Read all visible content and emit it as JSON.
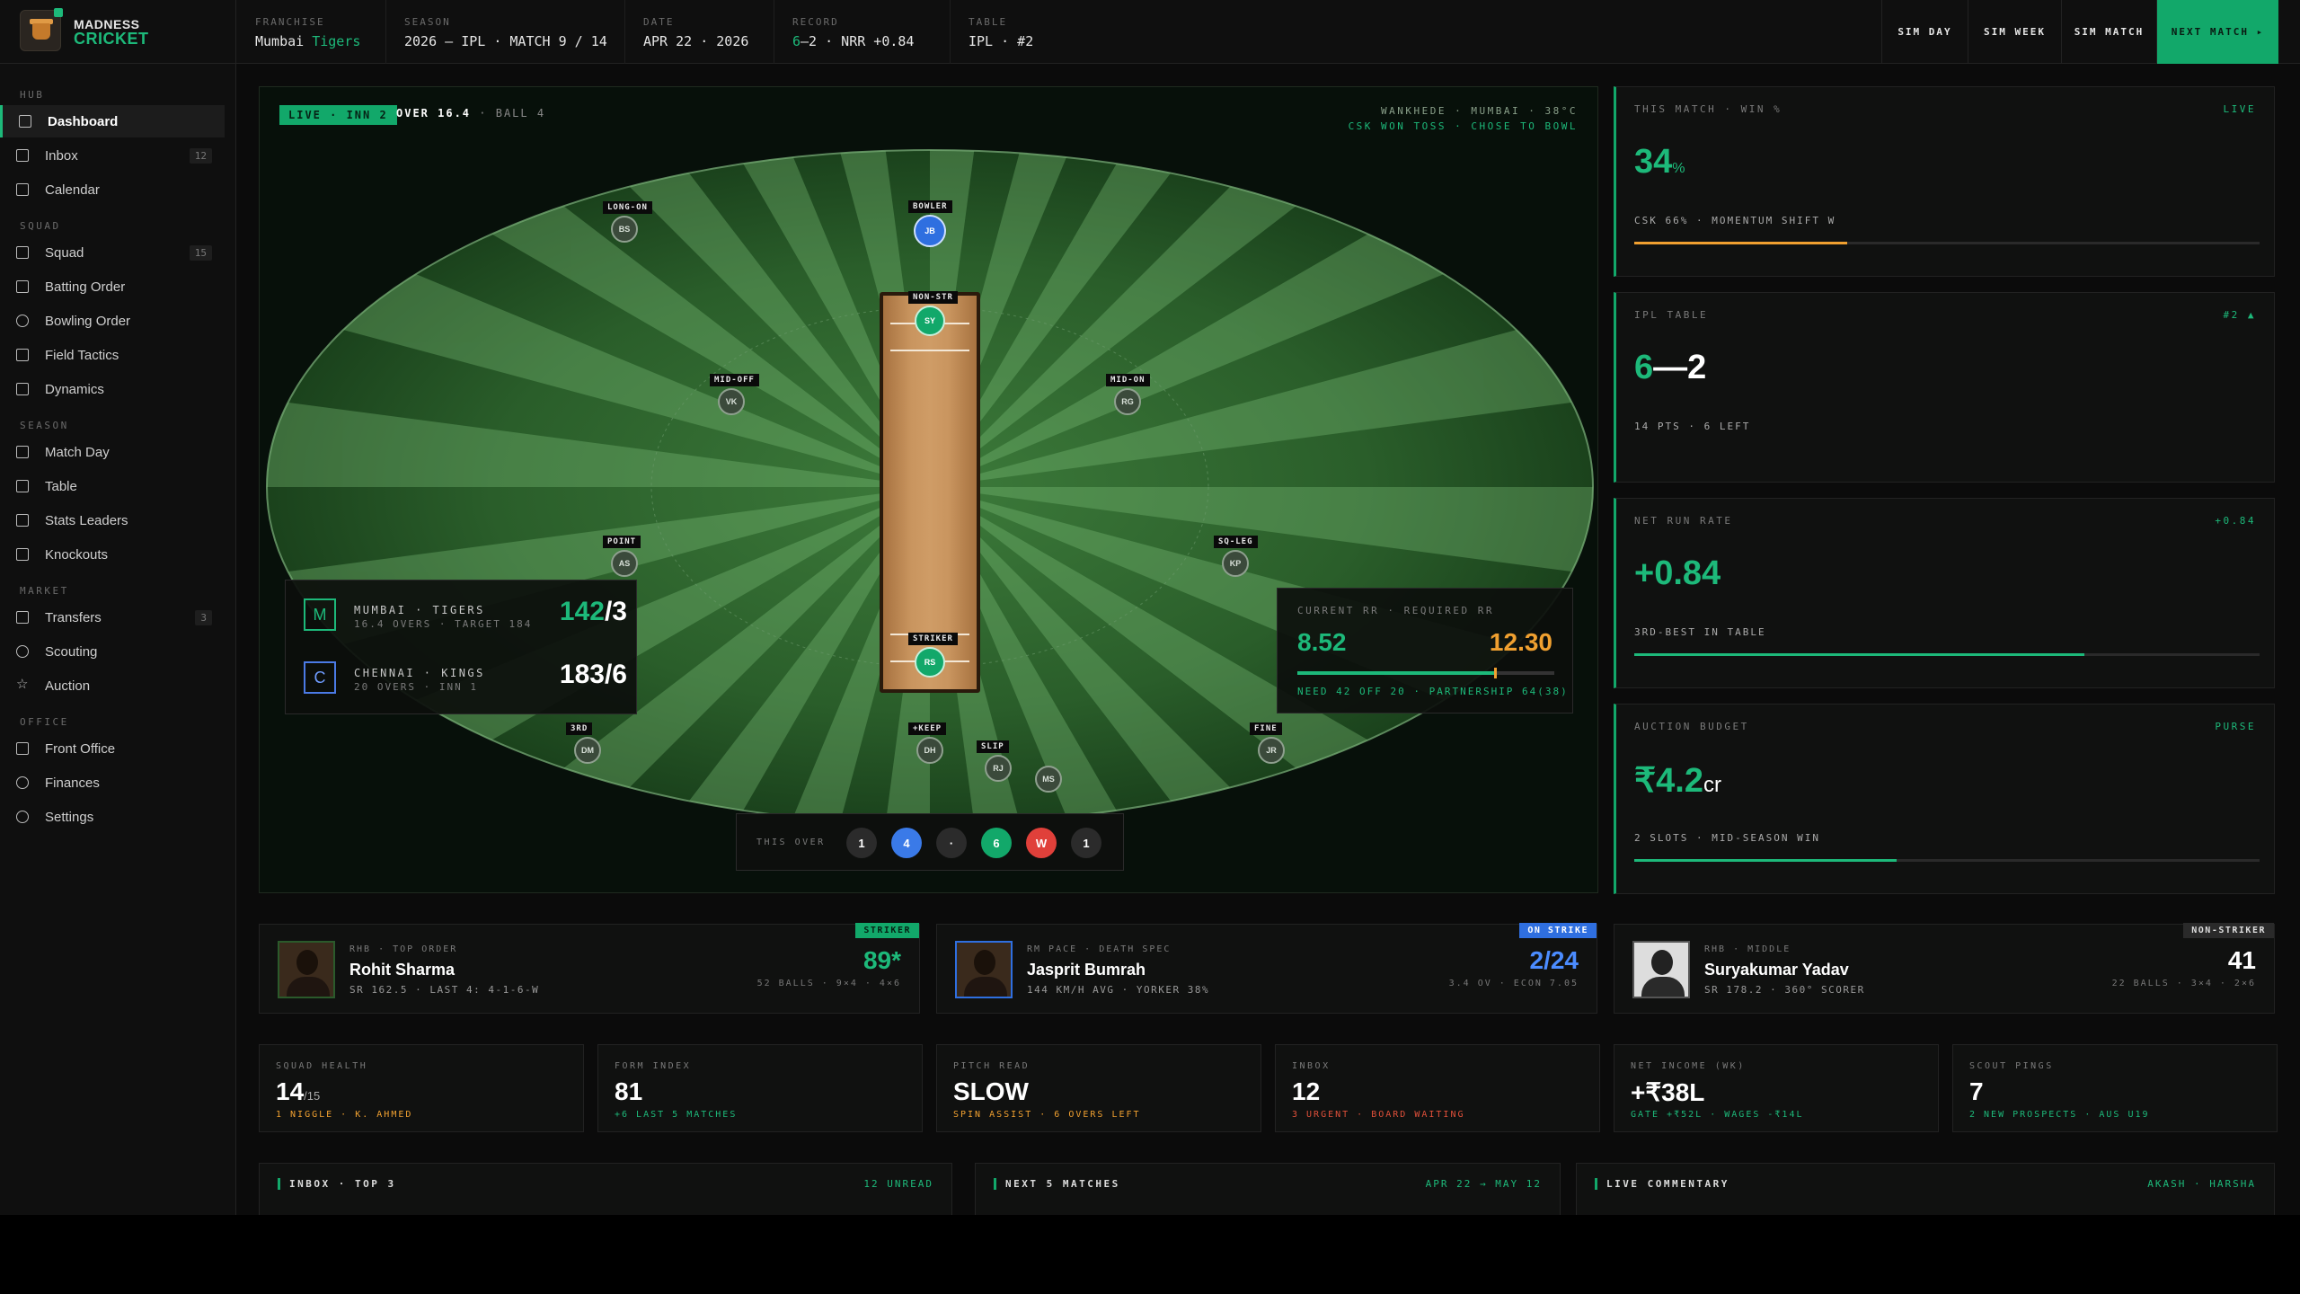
{
  "brand": {
    "line1": "MADNESS",
    "line2": "CRICKET"
  },
  "topbar": {
    "items": [
      {
        "label": "FRANCHISE",
        "value": "Mumbai",
        "accent": "Tigers"
      },
      {
        "label": "SEASON",
        "value": "2026 — IPL · MATCH 9 / 14"
      },
      {
        "label": "DATE",
        "value": "APR 22 · 2026"
      },
      {
        "label": "RECORD",
        "value": "–2 · NRR +0.84",
        "accent": "6"
      },
      {
        "label": "TABLE",
        "value": "IPL · #2"
      }
    ],
    "buttons": [
      "SIM DAY",
      "SIM WEEK",
      "SIM MATCH",
      "NEXT MATCH ▸"
    ]
  },
  "sidebar": {
    "sections": [
      {
        "title": "HUB",
        "items": [
          {
            "label": "Dashboard",
            "icon": "grid-icon",
            "active": true
          },
          {
            "label": "Inbox",
            "icon": "mail-icon",
            "badge": "12"
          },
          {
            "label": "Calendar",
            "icon": "calendar-icon"
          }
        ]
      },
      {
        "title": "SQUAD",
        "items": [
          {
            "label": "Squad",
            "icon": "user-icon",
            "badge": "15"
          },
          {
            "label": "Batting Order",
            "icon": "bat-icon"
          },
          {
            "label": "Bowling Order",
            "icon": "ball-icon"
          },
          {
            "label": "Field Tactics",
            "icon": "field-icon"
          },
          {
            "label": "Dynamics",
            "icon": "spark-icon"
          }
        ]
      },
      {
        "title": "SEASON",
        "items": [
          {
            "label": "Match Day",
            "icon": "pulse-icon"
          },
          {
            "label": "Table",
            "icon": "list-icon"
          },
          {
            "label": "Stats Leaders",
            "icon": "bars-icon"
          },
          {
            "label": "Knockouts",
            "icon": "trophy-icon"
          }
        ]
      },
      {
        "title": "MARKET",
        "items": [
          {
            "label": "Transfers",
            "icon": "swap-icon",
            "badge": "3"
          },
          {
            "label": "Scouting",
            "icon": "search-icon"
          },
          {
            "label": "Auction",
            "icon": "star-icon"
          }
        ]
      },
      {
        "title": "OFFICE",
        "items": [
          {
            "label": "Front Office",
            "icon": "building-icon"
          },
          {
            "label": "Finances",
            "icon": "coin-icon"
          },
          {
            "label": "Settings",
            "icon": "gear-icon"
          }
        ]
      }
    ]
  },
  "field": {
    "live_tag": "LIVE · INN 2",
    "over": "OVER 16.4",
    "ball": "· BALL 4",
    "venue_line1": "WANKHEDE · MUMBAI · 38°C",
    "venue_line2": "CSK WON TOSS · CHOSE TO BOWL",
    "fielders": [
      {
        "label": "LONG-ON",
        "initials": "BS"
      },
      {
        "label": "BOWLER",
        "initials": "JB"
      },
      {
        "label": "NON-STR",
        "initials": "SY"
      },
      {
        "label": "MID-OFF",
        "initials": "VK"
      },
      {
        "label": "MID-ON",
        "initials": "RG"
      },
      {
        "label": "POINT",
        "initials": "AS"
      },
      {
        "label": "SQ-LEG",
        "initials": "KP"
      },
      {
        "label": "STRIKER",
        "initials": "RS"
      },
      {
        "label": "3RD",
        "initials": "DM"
      },
      {
        "label": "+KEEP",
        "initials": "DH"
      },
      {
        "label": "SLIP",
        "initials": "RJ"
      },
      {
        "label": "",
        "initials": "MS"
      },
      {
        "label": "FINE",
        "initials": "JR"
      }
    ],
    "score": [
      {
        "badge": "M",
        "team": "MUMBAI · TIGERS",
        "sub": "16.4 OVERS · TARGET 184",
        "runs": "142",
        "wkts": "/3"
      },
      {
        "badge": "C",
        "team": "CHENNAI · KINGS",
        "sub": "20 OVERS · INN 1",
        "runs": "",
        "wkts": "183/6"
      }
    ],
    "rr": {
      "label": "CURRENT RR · REQUIRED RR",
      "current": "8.52",
      "required": "12.30",
      "progress": 0.77,
      "note": "NEED 42 OFF 20 · PARTNERSHIP 64(38)"
    },
    "this_over": {
      "label": "THIS OVER",
      "balls": [
        "1",
        "4",
        "·",
        "6",
        "W",
        "1"
      ]
    }
  },
  "cards": [
    {
      "label": "THIS MATCH · WIN %",
      "tag": "LIVE",
      "value": "34",
      "unit": "%",
      "note": "CSK 66% · MOMENTUM SHIFT W",
      "bar": 0.34,
      "bar_color": "#f0a030"
    },
    {
      "label": "IPL TABLE",
      "tag": "#2 ▲",
      "value": "6",
      "value2": "—2",
      "note": "14 PTS · 6 LEFT"
    },
    {
      "label": "NET RUN RATE",
      "tag": "+0.84",
      "value": "+0.84",
      "note": "3RD-BEST IN TABLE",
      "bar": 0.72,
      "bar_color": "#1db97a"
    },
    {
      "label": "AUCTION BUDGET",
      "tag": "PURSE",
      "value": "₹4.2",
      "unit": "cr",
      "note": "2 SLOTS · MID-SEASON WIN",
      "bar": 0.42,
      "bar_color": "#1db97a"
    }
  ],
  "players": [
    {
      "tag": "STRIKER",
      "role": "RHB · TOP ORDER",
      "name": "Rohit Sharma",
      "sub": "SR 162.5 · LAST 4: 4-1-6-W",
      "stat": "89*",
      "stat2": "52 BALLS · 9×4 · 4×6"
    },
    {
      "tag": "ON STRIKE",
      "role": "RM PACE · DEATH SPEC",
      "name": "Jasprit Bumrah",
      "sub": "144 KM/H AVG · YORKER 38%",
      "stat": "2/24",
      "stat2": "3.4 OV · ECON 7.05"
    },
    {
      "tag": "NON-STRIKER",
      "role": "RHB · MIDDLE",
      "name": "Suryakumar Yadav",
      "sub": "SR 178.2 · 360° SCORER",
      "stat": "41",
      "stat2": "22 BALLS · 3×4 · 2×6"
    }
  ],
  "kpis": [
    {
      "label": "SQUAD HEALTH",
      "value": "14",
      "unit": "/15",
      "note": "1 NIGGLE · K. AHMED",
      "note_color": "#f0a030"
    },
    {
      "label": "FORM INDEX",
      "value": "81",
      "unit": "",
      "note": "+6 LAST 5 MATCHES",
      "note_color": "#1db97a"
    },
    {
      "label": "PITCH READ",
      "value": "SLOW",
      "unit": "",
      "note": "SPIN ASSIST · 6 OVERS LEFT",
      "note_color": "#f0a030"
    },
    {
      "label": "INBOX",
      "value": "12",
      "unit": "",
      "note": "3 URGENT · BOARD WAITING",
      "note_color": "#e0503a"
    },
    {
      "label": "NET INCOME (WK)",
      "value": "+₹38L",
      "unit": "",
      "note": "GATE +₹52L · WAGES -₹14L",
      "note_color": "#1db97a"
    },
    {
      "label": "SCOUT PINGS",
      "value": "7",
      "unit": "",
      "note": "2 NEW PROSPECTS · AUS U19",
      "note_color": "#1db97a"
    }
  ],
  "bottom": [
    {
      "title": "INBOX · TOP 3",
      "right": "12 UNREAD"
    },
    {
      "title": "NEXT 5 MATCHES",
      "right": "APR 22 → MAY 12"
    },
    {
      "title": "LIVE COMMENTARY",
      "right": "AKASH · HARSHA"
    }
  ]
}
